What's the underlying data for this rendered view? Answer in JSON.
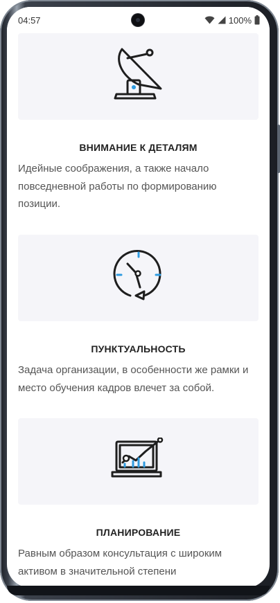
{
  "status_bar": {
    "time": "04:57",
    "battery": "100%",
    "icons": [
      "wifi-icon",
      "signal-icon",
      "battery-icon"
    ]
  },
  "features": [
    {
      "icon": "satellite-dish-icon",
      "title": "ВНИМАНИЕ К ДЕТАЛЯМ",
      "description": "Идейные соображения, а также начало повседневной работы по формированию позиции."
    },
    {
      "icon": "clock-icon",
      "title": "ПУНКТУАЛЬНОСТЬ",
      "description": "Задача организации, в особенности же рамки и место обучения кадров влечет за собой."
    },
    {
      "icon": "laptop-chart-icon",
      "title": "ПЛАНИРОВАНИЕ",
      "description": "Равным образом консультация с широким активом в значительной степени"
    }
  ],
  "colors": {
    "card_background": "#f5f5f9",
    "accent_blue": "#2f9be0",
    "icon_stroke": "#1e1e1e",
    "title_text": "#222222",
    "body_text": "#555555"
  }
}
